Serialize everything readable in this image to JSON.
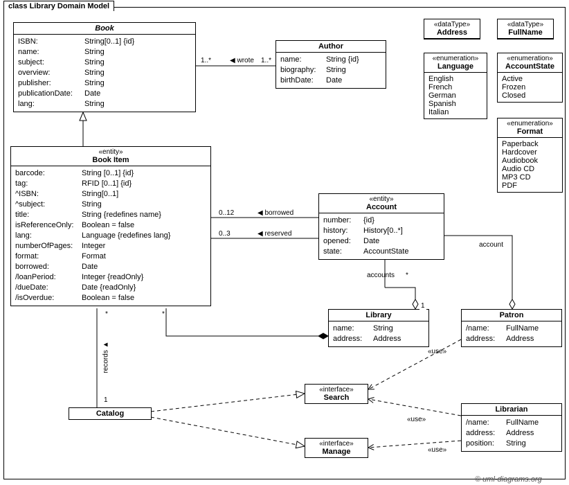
{
  "frame_title": "class Library Domain Model",
  "copyright": "© uml-diagrams.org",
  "datatypes": {
    "address": {
      "stereo": "«dataType»",
      "name": "Address"
    },
    "fullname": {
      "stereo": "«dataType»",
      "name": "FullName"
    }
  },
  "enums": {
    "language": {
      "stereo": "«enumeration»",
      "name": "Language",
      "values": [
        "English",
        "French",
        "German",
        "Spanish",
        "Italian"
      ]
    },
    "accountstate": {
      "stereo": "«enumeration»",
      "name": "AccountState",
      "values": [
        "Active",
        "Frozen",
        "Closed"
      ]
    },
    "format": {
      "stereo": "«enumeration»",
      "name": "Format",
      "values": [
        "Paperback",
        "Hardcover",
        "Audiobook",
        "Audio CD",
        "MP3 CD",
        "PDF"
      ]
    }
  },
  "classes": {
    "book": {
      "stereo": "",
      "name": "Book",
      "attrs": [
        {
          "k": "ISBN:",
          "v": "String[0..1] {id}"
        },
        {
          "k": "name:",
          "v": "String"
        },
        {
          "k": "subject:",
          "v": "String"
        },
        {
          "k": "overview:",
          "v": "String"
        },
        {
          "k": "publisher:",
          "v": "String"
        },
        {
          "k": "publicationDate:",
          "v": "Date"
        },
        {
          "k": "lang:",
          "v": "String"
        }
      ]
    },
    "author": {
      "stereo": "",
      "name": "Author",
      "attrs": [
        {
          "k": "name:",
          "v": "String {id}"
        },
        {
          "k": "biography:",
          "v": "String"
        },
        {
          "k": "birthDate:",
          "v": "Date"
        }
      ]
    },
    "bookitem": {
      "stereo": "«entity»",
      "name": "Book Item",
      "attrs": [
        {
          "k": "barcode:",
          "v": "String [0..1] {id}"
        },
        {
          "k": "tag:",
          "v": "RFID [0..1] {id}"
        },
        {
          "k": "^ISBN:",
          "v": "String[0..1]"
        },
        {
          "k": "^subject:",
          "v": "String"
        },
        {
          "k": "title:",
          "v": "String {redefines name}"
        },
        {
          "k": "isReferenceOnly:",
          "v": "Boolean = false"
        },
        {
          "k": "lang:",
          "v": "Language {redefines lang}"
        },
        {
          "k": "numberOfPages:",
          "v": "Integer"
        },
        {
          "k": "format:",
          "v": "Format"
        },
        {
          "k": "borrowed:",
          "v": "Date"
        },
        {
          "k": "/loanPeriod:",
          "v": "Integer {readOnly}"
        },
        {
          "k": "/dueDate:",
          "v": "Date {readOnly}"
        },
        {
          "k": "/isOverdue:",
          "v": "Boolean = false"
        }
      ]
    },
    "account": {
      "stereo": "«entity»",
      "name": "Account",
      "attrs": [
        {
          "k": "number:",
          "v": "{id}"
        },
        {
          "k": "history:",
          "v": "History[0..*]"
        },
        {
          "k": "opened:",
          "v": "Date"
        },
        {
          "k": "state:",
          "v": "AccountState"
        }
      ]
    },
    "library": {
      "stereo": "",
      "name": "Library",
      "attrs": [
        {
          "k": "name:",
          "v": "String"
        },
        {
          "k": "address:",
          "v": "Address"
        }
      ]
    },
    "patron": {
      "stereo": "",
      "name": "Patron",
      "attrs": [
        {
          "k": "/name:",
          "v": "FullName"
        },
        {
          "k": "address:",
          "v": "Address"
        }
      ]
    },
    "librarian": {
      "stereo": "",
      "name": "Librarian",
      "attrs": [
        {
          "k": "/name:",
          "v": "FullName"
        },
        {
          "k": "address:",
          "v": "Address"
        },
        {
          "k": "position:",
          "v": "String"
        }
      ]
    },
    "catalog": {
      "stereo": "",
      "name": "Catalog",
      "attrs": []
    },
    "search": {
      "stereo": "«interface»",
      "name": "Search",
      "attrs": []
    },
    "manage": {
      "stereo": "«interface»",
      "name": "Manage",
      "attrs": []
    }
  },
  "assoc": {
    "wrote": {
      "label": "wrote",
      "leftmult": "1..*",
      "rightmult": "1..*"
    },
    "borrowed": {
      "label": "borrowed",
      "mult": "0..12"
    },
    "reserved": {
      "label": "reserved",
      "mult": "0..3"
    },
    "accounts": "accounts",
    "account": "account",
    "records": "records",
    "use": "«use»",
    "star": "*",
    "one": "1"
  }
}
